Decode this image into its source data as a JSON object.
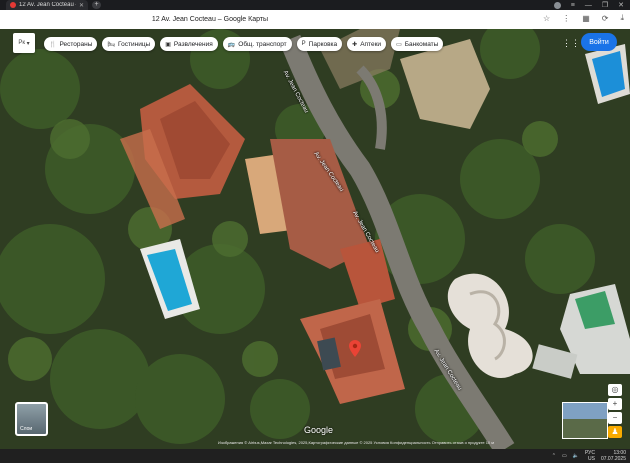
{
  "browser": {
    "tab_title": "12 Av. Jean Cocteau – G",
    "window_title": "12 Av. Jean Cocteau – Google Карты",
    "icons": [
      "star-icon",
      "menu-dots-icon",
      "extensions-icon",
      "profile-icon"
    ]
  },
  "map": {
    "layers_label": "Рк",
    "chips": [
      {
        "label": "Рестораны",
        "icon": "fork-knife-icon",
        "glyph": "🍴"
      },
      {
        "label": "Гостиницы",
        "icon": "bed-icon",
        "glyph": "🛏"
      },
      {
        "label": "Развлечения",
        "icon": "camera-icon",
        "glyph": "▣"
      },
      {
        "label": "Общ. транспорт",
        "icon": "bus-icon",
        "glyph": "🚌"
      },
      {
        "label": "Парковка",
        "icon": "parking-icon",
        "glyph": "P"
      },
      {
        "label": "Аптеки",
        "icon": "pharmacy-icon",
        "glyph": "✚"
      },
      {
        "label": "Банкоматы",
        "icon": "atm-icon",
        "glyph": "▭"
      }
    ],
    "signin_label": "Войти",
    "road_labels": [
      "Av. Jean Cocteau",
      "Av. Jean Cocteau",
      "Av. Jean Cocteau",
      "Av. Jean Cocteau"
    ],
    "layers_thumb_label": "Слои",
    "google_logo": "Google",
    "attribution": "Изображения © Airbus,Maxar Technologies, 2025,Картографические данные © 2025   Условия   Конфиденциальность   Отправить отзыв о продукте   10 м"
  },
  "taskbar": {
    "lang": "РУС",
    "lang_sub": "US",
    "time": "13:00",
    "date": "07.07.2025"
  }
}
